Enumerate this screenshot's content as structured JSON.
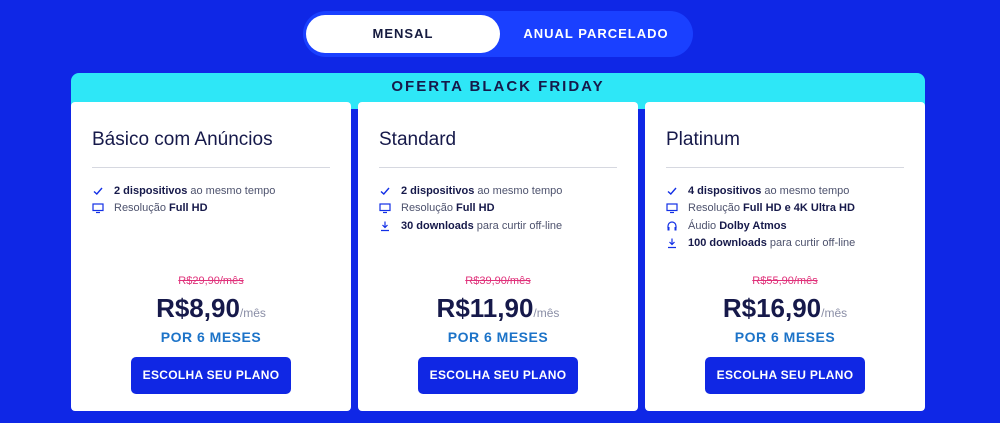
{
  "billing_toggle": {
    "monthly_label": "MENSAL",
    "annual_label": "ANUAL PARCELADO",
    "selected": "MENSAL"
  },
  "offer_banner": {
    "text": "OFERTA BLACK FRIDAY"
  },
  "plans": [
    {
      "name": "Básico com Anúncios",
      "features": [
        {
          "icon": "check-icon",
          "bold": "2 dispositivos",
          "text": "ao mesmo tempo"
        },
        {
          "icon": "monitor-icon",
          "bold": "",
          "text": "Resolução",
          "bold_after": "Full HD"
        }
      ],
      "old_price": "R$29,90/mês",
      "price": "R$8,90",
      "per": "/mês",
      "period": "POR 6 MESES",
      "cta": "ESCOLHA SEU PLANO"
    },
    {
      "name": "Standard",
      "features": [
        {
          "icon": "check-icon",
          "bold": "2 dispositivos",
          "text": "ao mesmo tempo"
        },
        {
          "icon": "monitor-icon",
          "bold": "",
          "text": "Resolução",
          "bold_after": "Full HD"
        },
        {
          "icon": "download-icon",
          "bold": "30 downloads",
          "text": "para curtir off-line"
        }
      ],
      "old_price": "R$39,90/mês",
      "price": "R$11,90",
      "per": "/mês",
      "period": "POR 6 MESES",
      "cta": "ESCOLHA SEU PLANO"
    },
    {
      "name": "Platinum",
      "features": [
        {
          "icon": "check-icon",
          "bold": "4 dispositivos",
          "text": "ao mesmo tempo"
        },
        {
          "icon": "monitor-icon",
          "bold": "",
          "text": "Resolução",
          "bold_after": "Full HD e 4K Ultra HD"
        },
        {
          "icon": "headphones-icon",
          "bold": "",
          "text": "Áudio",
          "bold_after": "Dolby Atmos"
        },
        {
          "icon": "download-icon",
          "bold": "100 downloads",
          "text": "para curtir off-line"
        }
      ],
      "old_price": "R$55,90/mês",
      "price": "R$16,90",
      "per": "/mês",
      "period": "POR 6 MESES",
      "cta": "ESCOLHA SEU PLANO"
    }
  ],
  "colors": {
    "background": "#0f27e6",
    "banner": "#2ee7f7",
    "button": "#1027e4",
    "old_price": "#e0317a",
    "period": "#1c73c8"
  }
}
